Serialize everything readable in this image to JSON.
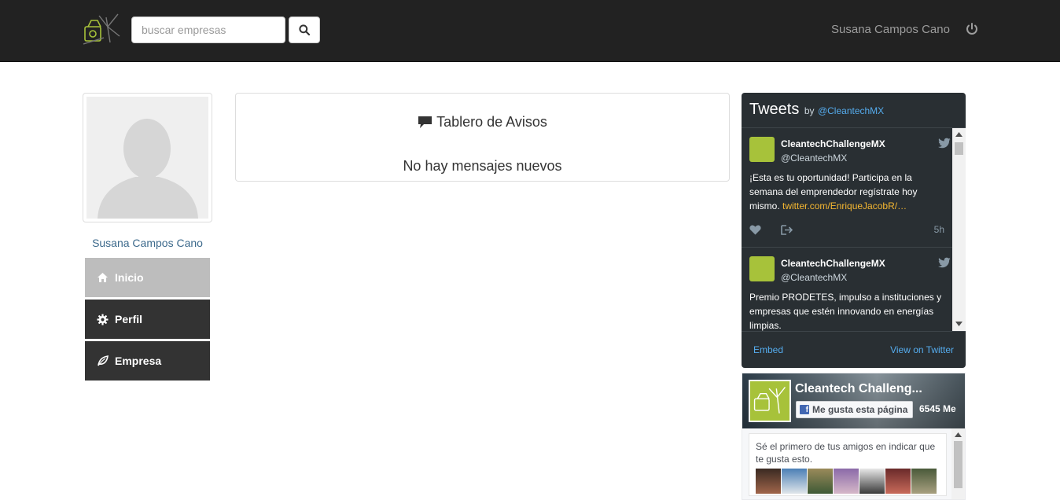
{
  "navbar": {
    "search_placeholder": "buscar empresas",
    "user_name": "Susana Campos Cano"
  },
  "sidebar": {
    "user_name": "Susana Campos Cano",
    "items": [
      {
        "label": "Inicio",
        "icon": "home-icon",
        "active": true
      },
      {
        "label": "Perfil",
        "icon": "gear-icon",
        "active": false
      },
      {
        "label": "Empresa",
        "icon": "leaf-icon",
        "active": false
      }
    ]
  },
  "board": {
    "title": "Tablero de Avisos",
    "message": "No hay mensajes nuevos"
  },
  "twitter": {
    "title": "Tweets",
    "by": "by",
    "handle": "@CleantechMX",
    "tweets": [
      {
        "name": "CleantechChallengeMX",
        "user": "@CleantechMX",
        "text": "¡Esta es tu oportunidad! Participa en la semana del emprendedor regístrate hoy mismo.",
        "link": "twitter.com/EnriqueJacobR/…",
        "time": "5h"
      },
      {
        "name": "CleantechChallengeMX",
        "user": "@CleantechMX",
        "text": "Premio PRODETES, impulso a instituciones y empresas que estén innovando en energías limpias."
      }
    ],
    "embed": "Embed",
    "view": "View on Twitter"
  },
  "facebook": {
    "page_name": "Cleantech Challeng...",
    "like_label": "Me gusta esta página",
    "like_count": "6545 Me",
    "friends_text": "Sé el primero de tus amigos en indicar que te gusta esto."
  },
  "colors": {
    "navbar_bg": "#222222",
    "sidebar_active": "#bdbdbd",
    "sidebar_item": "#333333",
    "twitter_bg": "#292f33",
    "twitter_link": "#55acee",
    "tweet_link": "#f5b731",
    "brand_green": "#a7c23a"
  }
}
